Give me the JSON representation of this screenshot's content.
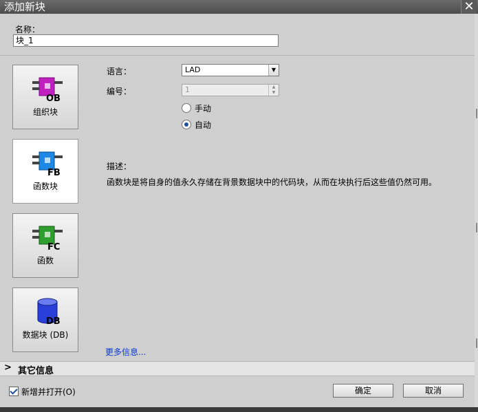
{
  "window": {
    "title": "添加新块",
    "close_glyph": "✕"
  },
  "name": {
    "label": "名称：",
    "value": "块_1"
  },
  "blocks": [
    {
      "code": "OB",
      "label": "组织块",
      "color": "#c020c0",
      "selected": false
    },
    {
      "code": "FB",
      "label": "函数块",
      "color": "#1e88e5",
      "selected": true
    },
    {
      "code": "FC",
      "label": "函数",
      "color": "#2e9e2e",
      "selected": false
    },
    {
      "code": "DB",
      "label": "数据块 (DB)",
      "color": "#2a3fd8",
      "selected": false
    }
  ],
  "form": {
    "language_label": "语言：",
    "language_value": "LAD",
    "number_label": "编号：",
    "number_value": "1",
    "radio_manual": "手动",
    "radio_auto": "自动",
    "radio_selected": "auto"
  },
  "description": {
    "label": "描述：",
    "text": "函数块是将自身的值永久存储在背景数据块中的代码块，从而在块执行后这些值仍然可用。"
  },
  "more_info": "更多信息...",
  "other_info": {
    "title": "其它信息"
  },
  "footer": {
    "open_label": "新增并打开(O)",
    "open_checked": true,
    "ok": "确定",
    "cancel": "取消"
  }
}
